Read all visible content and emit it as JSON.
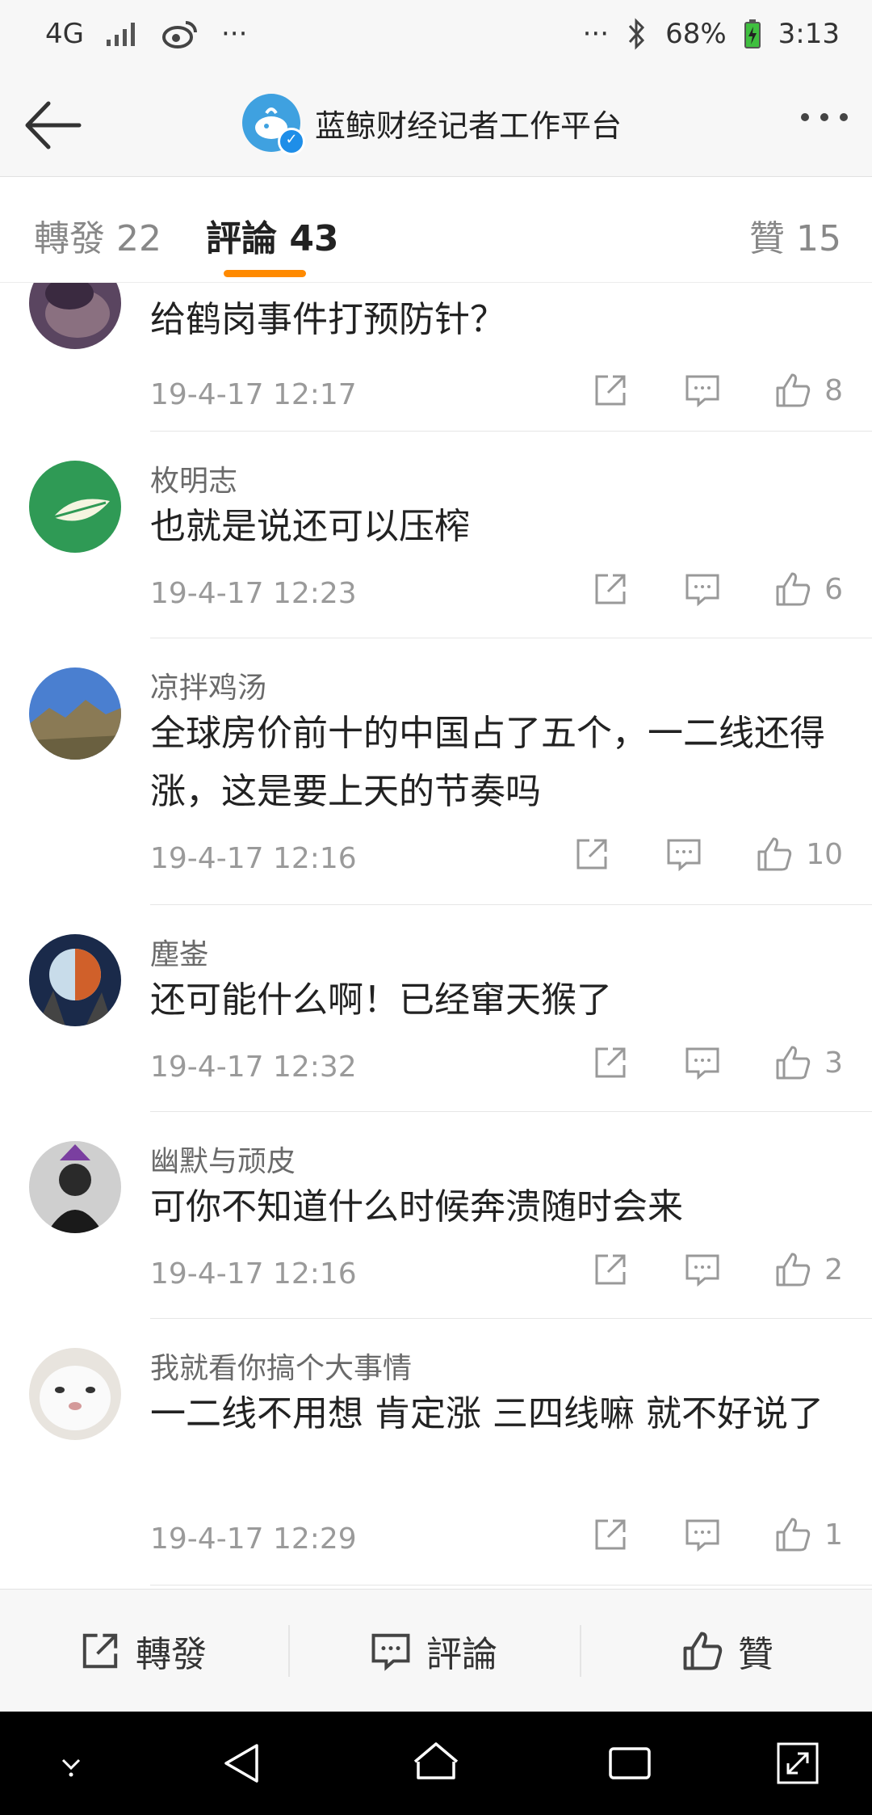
{
  "status_bar": {
    "network": "4G",
    "battery": "68%",
    "time": "3:13",
    "more": "···",
    "more_right": "···"
  },
  "header": {
    "account_name": "蓝鲸财经记者工作平台",
    "verified_mark": "✓"
  },
  "tabs": {
    "repost": "轉發 22",
    "comment": "評論 43",
    "like": "贊 15"
  },
  "comments": [
    {
      "username": "",
      "text": "给鹤岗事件打预防针？",
      "time": "19-4-17 12:17",
      "likes": "8"
    },
    {
      "username": "枚明志",
      "text": "也就是说还可以压榨",
      "time": "19-4-17 12:23",
      "likes": "6"
    },
    {
      "username": "凉拌鸡汤",
      "text": "全球房价前十的中国占了五个，一二线还得涨，这是要上天的节奏吗",
      "time": "19-4-17 12:16",
      "likes": "10"
    },
    {
      "username": "塵崟",
      "text": "还可能什么啊！已经窜天猴了",
      "time": "19-4-17 12:32",
      "likes": "3"
    },
    {
      "username": "幽默与顽皮",
      "text": "可你不知道什么时候奔溃随时会来",
      "time": "19-4-17 12:16",
      "likes": "2"
    },
    {
      "username": "我就看你搞个大事情",
      "text": "一二线不用想 肯定涨 三四线嘛 就不好说了",
      "time": "19-4-17 12:29",
      "likes": "1"
    }
  ],
  "bottom_bar": {
    "repost": "轉發",
    "comment": "評論",
    "like": "贊"
  }
}
